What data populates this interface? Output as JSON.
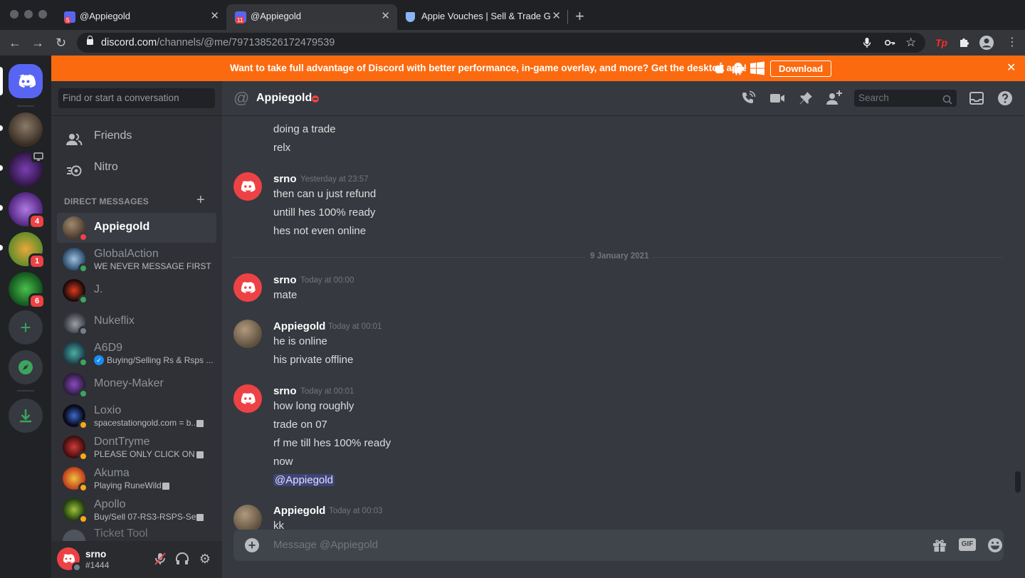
{
  "browser": {
    "tabs": [
      {
        "title": "@Appiegold",
        "badge": "5"
      },
      {
        "title": "@Appiegold",
        "badge": "11"
      },
      {
        "title": "Appie Vouches | Sell & Trade G"
      }
    ],
    "url_host": "discord.com",
    "url_path": "/channels/@me/797138526172479539",
    "ext_tp": "Tp"
  },
  "banner": {
    "message": "Want to take full advantage of Discord with better performance, in-game overlay, and more? Get the desktop app!",
    "download_label": "Download"
  },
  "servers": [
    {
      "name": "server-1",
      "color": "#5a4a3a",
      "badge": ""
    },
    {
      "name": "server-2",
      "color": "#5b2d7d",
      "badge": ""
    },
    {
      "name": "server-space-station",
      "color": "#7a3fb0",
      "badge": "4"
    },
    {
      "name": "server-peanut",
      "color": "#c47a1a",
      "badge": "1"
    },
    {
      "name": "server-lucky",
      "color": "#1f8a2e",
      "badge": "6"
    }
  ],
  "sidebar": {
    "search_placeholder": "Find or start a conversation",
    "friends_label": "Friends",
    "nitro_label": "Nitro",
    "dm_header": "DIRECT MESSAGES",
    "dms": [
      {
        "name": "Appiegold",
        "sub": "",
        "status": "dnd",
        "av": "#6b5a45"
      },
      {
        "name": "GlobalAction",
        "sub": "WE NEVER MESSAGE FIRST",
        "status": "online",
        "av": "#5a7a9a"
      },
      {
        "name": "J.",
        "sub": "",
        "status": "online",
        "av": "#3a1a1a"
      },
      {
        "name": "Nukeflix",
        "sub": "",
        "status": "offline",
        "av": "#3a3f48"
      },
      {
        "name": "A6D9",
        "sub": "Buying/Selling Rs & Rsps ...",
        "status": "online",
        "av": "#2a6b5a"
      },
      {
        "name": "Money-Maker",
        "sub": "",
        "status": "online",
        "av": "#4a2a6a"
      },
      {
        "name": "Loxio",
        "sub": "spacestationgold.com = b...",
        "status": "idle",
        "av": "#1a1a2a"
      },
      {
        "name": "DontTryme",
        "sub": "PLEASE ONLY CLICK ON ...",
        "status": "idle",
        "av": "#7a1a1a"
      },
      {
        "name": "Akuma",
        "sub": "Playing RuneWild",
        "status": "idle",
        "av": "#c43a1a"
      },
      {
        "name": "Apollo",
        "sub": "Buy/Sell 07-RS3-RSPS-Se...",
        "status": "idle",
        "av": "#3a6a1a"
      },
      {
        "name": "Ticket Tool",
        "sub": "",
        "status": "",
        "av": "#3a3c42"
      }
    ]
  },
  "user": {
    "name": "srno",
    "tag": "#1444"
  },
  "chat": {
    "header_title": "Appiegold",
    "search_placeholder": "Search",
    "composer_placeholder": "Message @Appiegold",
    "gif_label": "GIF",
    "lines_top": [
      "doing a trade",
      "relx"
    ],
    "date_divider": "9 January 2021",
    "groups": [
      {
        "author": "srno",
        "time": "Yesterday at 23:57",
        "lines": [
          "then can u just refund",
          "untill hes 100% ready",
          "hes not even online"
        ]
      },
      {
        "author": "srno",
        "time": "Today at 00:00",
        "lines": [
          "mate"
        ]
      },
      {
        "author": "Appiegold",
        "time": "Today at 00:01",
        "lines": [
          "he is online",
          "his private offline"
        ]
      },
      {
        "author": "srno",
        "time": "Today at 00:01",
        "lines": [
          "how long roughly",
          "trade on 07",
          "rf me till hes 100% ready",
          "now",
          "@Appiegold"
        ]
      },
      {
        "author": "Appiegold",
        "time": "Today at 00:03",
        "lines": [
          "kk"
        ]
      }
    ]
  }
}
